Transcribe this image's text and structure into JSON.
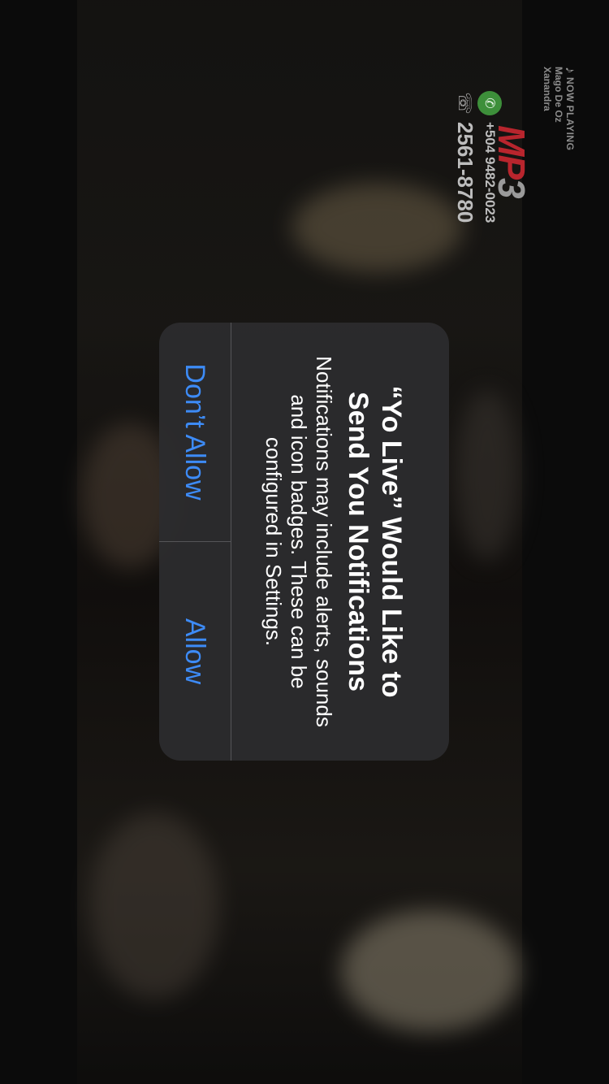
{
  "now_playing": {
    "label": "NOW PLAYING",
    "artist": "Mago De Oz",
    "track": "Xanandra"
  },
  "brand": {
    "logo_text": "MP",
    "logo_text_suffix": "3",
    "whatsapp_number": "+504 9482-0023",
    "phone_number": "2561-8780"
  },
  "alert": {
    "title": "“Yo Live” Would Like to Send You Notifications",
    "message": "Notifications may include alerts, sounds and icon badges. These can be configured in Settings.",
    "dont_allow_label": "Don’t Allow",
    "allow_label": "Allow"
  },
  "colors": {
    "alert_button": "#3d8bf6",
    "alert_background": "#2c2c2e",
    "brand_red": "#b8252d",
    "whatsapp_green": "#3d8f3a"
  },
  "icons": [
    "music-note-icon",
    "whatsapp-icon",
    "phone-icon"
  ]
}
